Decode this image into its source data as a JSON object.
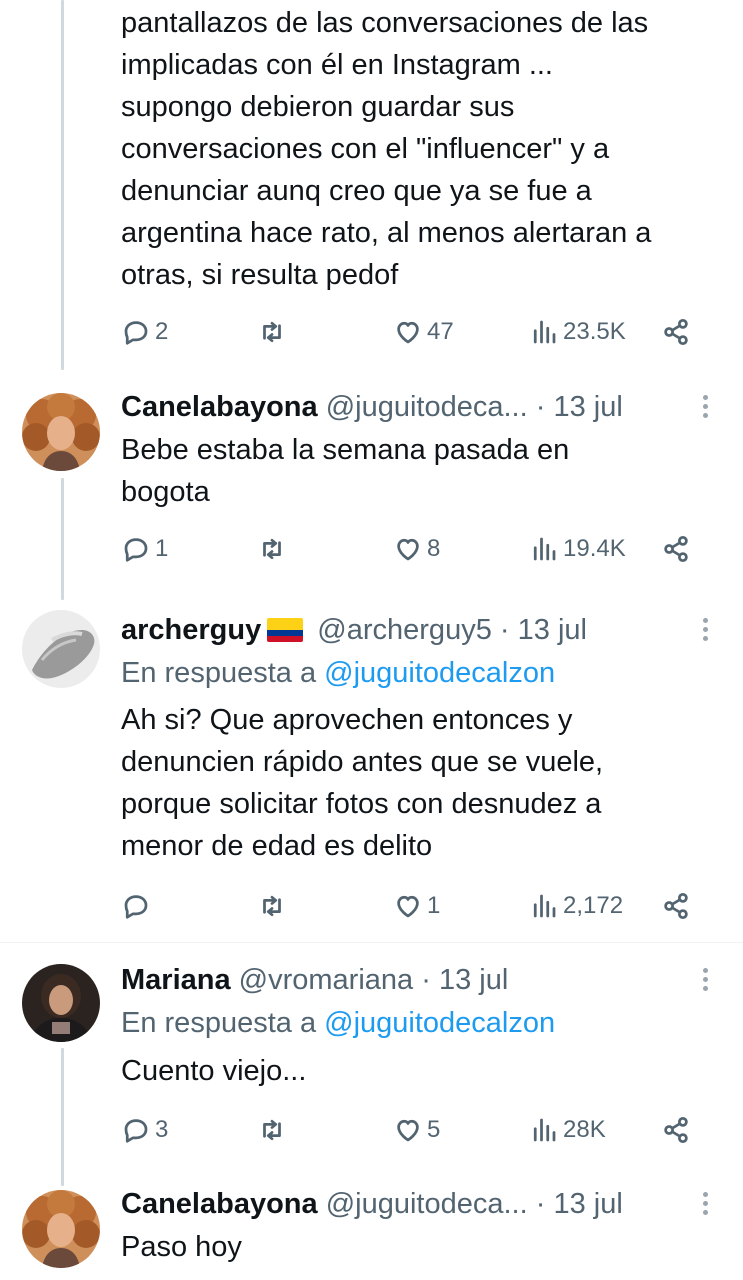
{
  "top_tweet": {
    "text": "pantallazos de las conversaciones de las\nimplicadas  con él en Instagram ...\nsupongo debieron guardar sus\nconversaciones con  el \"influencer\" y a\ndenunciar aunq creo que ya se fue a\nargentina hace rato, al menos alertaran a\notras, si resulta pedof",
    "replies": "2",
    "retweets": "",
    "likes": "47",
    "views": "23.5K"
  },
  "tweets": [
    {
      "name": "Canelabayona",
      "handle": "@juguitodeca...",
      "time": "13 jul",
      "text": "Bebe estaba la semana pasada en\nbogota",
      "replies": "1",
      "retweets": "",
      "likes": "8",
      "views": "19.4K"
    },
    {
      "name": "archerguy",
      "handle": "@archerguy5",
      "time": "13 jul",
      "reply_prefix": "En respuesta a",
      "reply_mention": "@juguitodecalzon",
      "text": "Ah si? Que aprovechen entonces y\ndenuncien rápido antes que se vuele,\nporque solicitar fotos con desnudez a\nmenor de edad es delito",
      "replies": "",
      "retweets": "",
      "likes": "1",
      "views": "2,172"
    },
    {
      "name": "Mariana",
      "handle": "@vromariana",
      "time": "13 jul",
      "reply_prefix": "En respuesta a",
      "reply_mention": "@juguitodecalzon",
      "text": "Cuento viejo...",
      "replies": "3",
      "retweets": "",
      "likes": "5",
      "views": "28K"
    },
    {
      "name": "Canelabayona",
      "handle": "@juguitodeca...",
      "time": "13 jul",
      "text": "Paso hoy"
    }
  ],
  "separator": "·",
  "colors": {
    "text": "#0f1419",
    "secondary": "#536471",
    "link": "#1d9bf0",
    "thread_line": "#cfd9de",
    "flag": [
      "#fcd116",
      "#003893",
      "#ce1126"
    ]
  },
  "icons": {
    "reply": "reply-icon",
    "retweet": "retweet-icon",
    "like": "heart-icon",
    "views": "views-icon",
    "share": "share-icon",
    "more": "more-icon"
  }
}
